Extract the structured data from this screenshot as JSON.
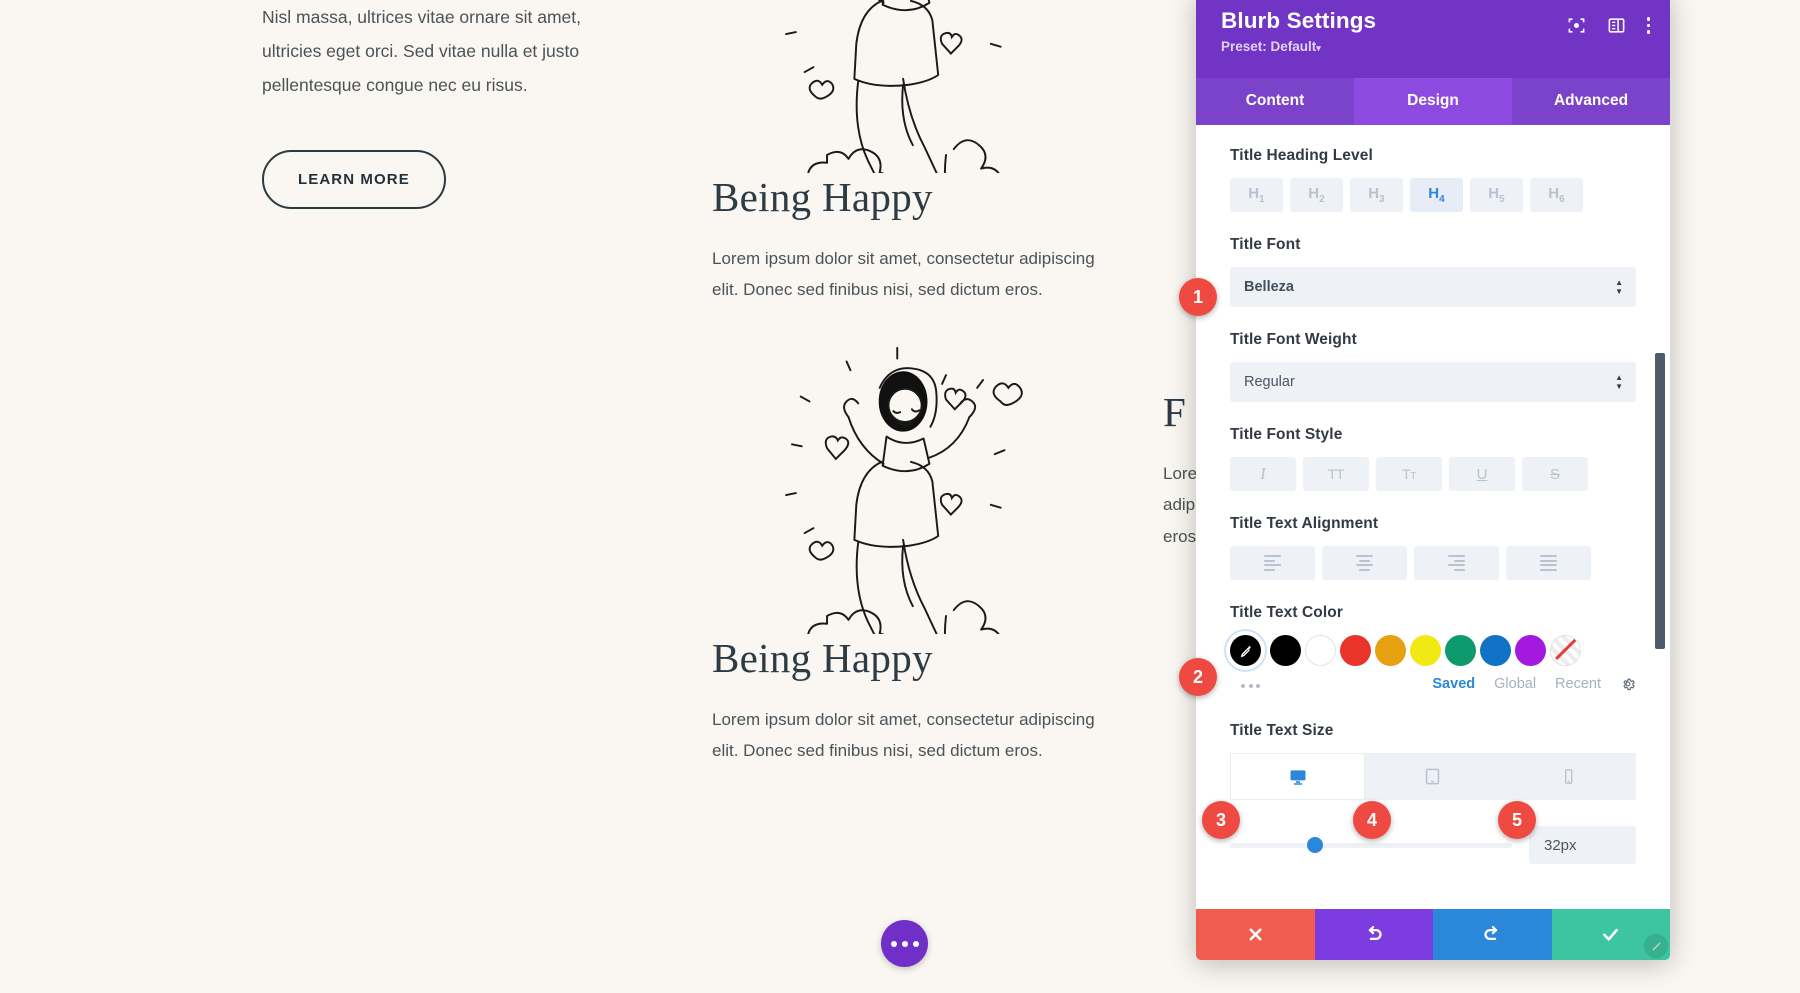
{
  "website": {
    "column_a": {
      "paragraph": "Nisl massa, ultrices vitae ornare sit amet, ultricies eget orci. Sed vitae nulla et justo pellentesque congue nec eu risus.",
      "button_label": "LEARN MORE"
    },
    "column_b": {
      "blurb1_title": "Being Happy",
      "blurb1_text": "Lorem ipsum dolor sit amet, consectetur adipiscing elit. Donec sed finibus nisi, sed dictum eros.",
      "blurb2_title": "Being Happy",
      "blurb2_text": "Lorem ipsum dolor sit amet, consectetur adipiscing elit. Donec sed finibus nisi, sed dictum eros."
    },
    "column_c": {
      "blurb_title": "F",
      "blurb_text_line1": "Lore",
      "blurb_text_line2": "adip",
      "blurb_text_line3": "eros"
    },
    "fab_label": "more-options"
  },
  "modal": {
    "title": "Blurb Settings",
    "preset": "Preset: Default",
    "preset_caret": "▾",
    "header_icons": [
      {
        "name": "focus-frame-icon"
      },
      {
        "name": "layout-panel-icon"
      },
      {
        "name": "kebab-menu-icon"
      }
    ],
    "tabs": [
      {
        "label": "Content",
        "active": false
      },
      {
        "label": "Design",
        "active": true
      },
      {
        "label": "Advanced",
        "active": false
      }
    ],
    "fields": {
      "heading_level": {
        "label": "Title Heading Level",
        "options": [
          "H1",
          "H2",
          "H3",
          "H4",
          "H5",
          "H6"
        ],
        "selected": "H4"
      },
      "title_font": {
        "label": "Title Font",
        "value": "Belleza"
      },
      "title_font_weight": {
        "label": "Title Font Weight",
        "value": "Regular"
      },
      "title_font_style": {
        "label": "Title Font Style",
        "options": [
          "italic-icon",
          "uppercase-icon",
          "small-caps-icon",
          "underline-icon",
          "strikethrough-icon"
        ],
        "glyphs": [
          "I",
          "TT",
          "Tт",
          "U",
          "S"
        ],
        "selected": null
      },
      "title_text_alignment": {
        "label": "Title Text Alignment",
        "options": [
          "align-left-icon",
          "align-center-icon",
          "align-right-icon",
          "align-justify-icon"
        ],
        "selected": null
      },
      "title_text_color": {
        "label": "Title Text Color",
        "picker": "eyedropper-icon",
        "swatches": [
          "#000000",
          "#ffffff",
          "#e8342a",
          "#e7a010",
          "#f0e913",
          "#0f9a6e",
          "#1273c6",
          "#a319e0",
          "none"
        ],
        "more_label": "more-colors",
        "tabs": [
          {
            "label": "Saved",
            "active": true
          },
          {
            "label": "Global",
            "active": false
          },
          {
            "label": "Recent",
            "active": false
          }
        ],
        "settings_icon": "gear-icon"
      },
      "title_text_size": {
        "label": "Title Text Size",
        "devices": [
          {
            "name": "desktop-icon",
            "active": true
          },
          {
            "name": "tablet-icon",
            "active": false
          },
          {
            "name": "phone-icon",
            "active": false
          }
        ],
        "slider_percent": 30,
        "value": "32px"
      }
    },
    "footer": [
      {
        "name": "cancel-button",
        "icon": "close-icon"
      },
      {
        "name": "undo-button",
        "icon": "undo-icon"
      },
      {
        "name": "redo-button",
        "icon": "redo-icon"
      },
      {
        "name": "save-button",
        "icon": "check-icon"
      }
    ]
  },
  "badges": [
    {
      "number": "1"
    },
    {
      "number": "2"
    },
    {
      "number": "3"
    },
    {
      "number": "4"
    },
    {
      "number": "5"
    }
  ],
  "colors": {
    "accent_purple": "#7134c4",
    "tab_active": "#8d4ae0",
    "blue": "#2b87da",
    "badge_red": "#ef4a42",
    "save_green": "#3dc4a0",
    "cancel_red": "#f05c50",
    "page_bg": "#faf7f2"
  }
}
